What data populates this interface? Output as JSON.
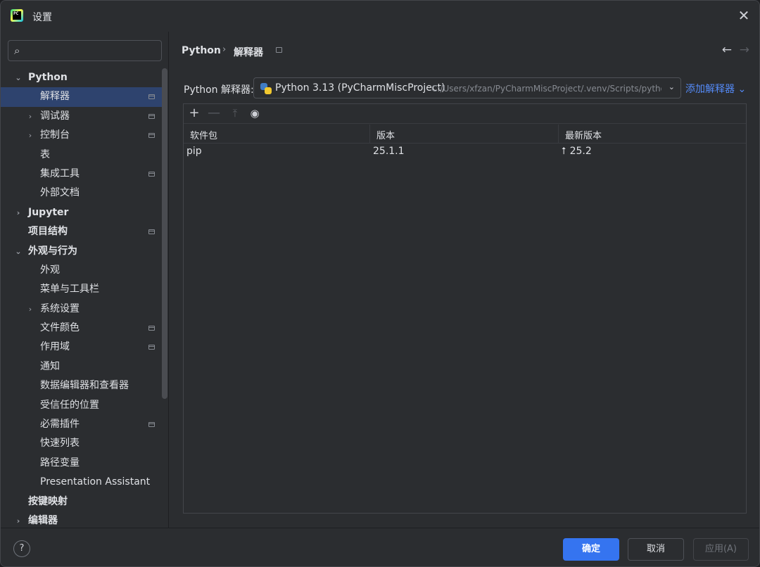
{
  "window": {
    "title": "设置",
    "close_glyph": "✕"
  },
  "search": {
    "placeholder": ""
  },
  "sidebar": {
    "items": [
      {
        "label": "Python",
        "level": 0,
        "expander": "expanded",
        "bold": true,
        "project_icon": false,
        "selected": false
      },
      {
        "label": "解释器",
        "level": 1,
        "expander": "none",
        "bold": false,
        "project_icon": true,
        "selected": true
      },
      {
        "label": "调试器",
        "level": 1,
        "expander": "collapsed",
        "bold": false,
        "project_icon": true,
        "selected": false
      },
      {
        "label": "控制台",
        "level": 1,
        "expander": "collapsed",
        "bold": false,
        "project_icon": true,
        "selected": false
      },
      {
        "label": "表",
        "level": 1,
        "expander": "none",
        "bold": false,
        "project_icon": false,
        "selected": false
      },
      {
        "label": "集成工具",
        "level": 1,
        "expander": "none",
        "bold": false,
        "project_icon": true,
        "selected": false
      },
      {
        "label": "外部文档",
        "level": 1,
        "expander": "none",
        "bold": false,
        "project_icon": false,
        "selected": false
      },
      {
        "label": "Jupyter",
        "level": 0,
        "expander": "collapsed",
        "bold": true,
        "project_icon": false,
        "selected": false
      },
      {
        "label": "项目结构",
        "level": 0,
        "expander": "none",
        "bold": true,
        "project_icon": true,
        "selected": false
      },
      {
        "label": "外观与行为",
        "level": 0,
        "expander": "expanded",
        "bold": true,
        "project_icon": false,
        "selected": false
      },
      {
        "label": "外观",
        "level": 1,
        "expander": "none",
        "bold": false,
        "project_icon": false,
        "selected": false
      },
      {
        "label": "菜单与工具栏",
        "level": 1,
        "expander": "none",
        "bold": false,
        "project_icon": false,
        "selected": false
      },
      {
        "label": "系统设置",
        "level": 1,
        "expander": "collapsed",
        "bold": false,
        "project_icon": false,
        "selected": false
      },
      {
        "label": "文件颜色",
        "level": 1,
        "expander": "none",
        "bold": false,
        "project_icon": true,
        "selected": false
      },
      {
        "label": "作用域",
        "level": 1,
        "expander": "none",
        "bold": false,
        "project_icon": true,
        "selected": false
      },
      {
        "label": "通知",
        "level": 1,
        "expander": "none",
        "bold": false,
        "project_icon": false,
        "selected": false
      },
      {
        "label": "数据编辑器和查看器",
        "level": 1,
        "expander": "none",
        "bold": false,
        "project_icon": false,
        "selected": false
      },
      {
        "label": "受信任的位置",
        "level": 1,
        "expander": "none",
        "bold": false,
        "project_icon": false,
        "selected": false
      },
      {
        "label": "必需插件",
        "level": 1,
        "expander": "none",
        "bold": false,
        "project_icon": true,
        "selected": false
      },
      {
        "label": "快速列表",
        "level": 1,
        "expander": "none",
        "bold": false,
        "project_icon": false,
        "selected": false
      },
      {
        "label": "路径变量",
        "level": 1,
        "expander": "none",
        "bold": false,
        "project_icon": false,
        "selected": false
      },
      {
        "label": "Presentation Assistant",
        "level": 1,
        "expander": "none",
        "bold": false,
        "project_icon": false,
        "selected": false
      },
      {
        "label": "按键映射",
        "level": 0,
        "expander": "none",
        "bold": true,
        "project_icon": false,
        "selected": false
      },
      {
        "label": "编辑器",
        "level": 0,
        "expander": "collapsed",
        "bold": true,
        "project_icon": false,
        "selected": false
      }
    ]
  },
  "breadcrumb": {
    "parent": "Python",
    "separator": "›",
    "current": "解释器"
  },
  "nav": {
    "back": "←",
    "forward": "→"
  },
  "interpreter": {
    "label": "Python 解释器:",
    "name": "Python 3.13 (PyCharmMiscProject)",
    "path": "C:/Users/xfzan/PyCharmMiscProject/.venv/Scripts/python.exe",
    "add_label": "添加解释器"
  },
  "toolbar": {
    "add": "+",
    "remove": "—",
    "upgrade": "⤒",
    "show": "◉"
  },
  "table": {
    "columns": [
      "软件包",
      "版本",
      "最新版本"
    ],
    "rows": [
      {
        "package": "pip",
        "version": "25.1.1",
        "latest": "25.2",
        "upgrade_available": true
      }
    ]
  },
  "footer": {
    "help": "?",
    "ok": "确定",
    "cancel": "取消",
    "apply": "应用(A)"
  },
  "colors": {
    "accent": "#3574f0",
    "link": "#548af7",
    "selection": "#2e436e",
    "background": "#2b2d30"
  }
}
